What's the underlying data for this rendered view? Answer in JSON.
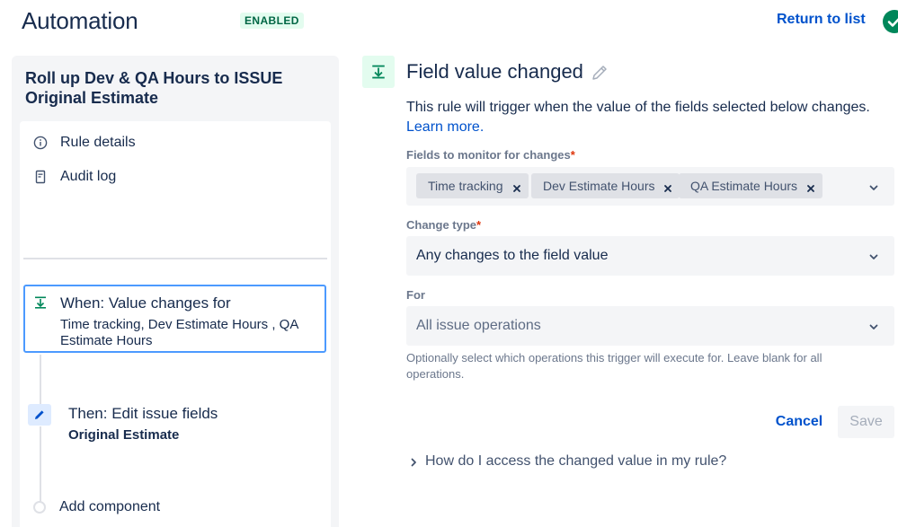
{
  "header": {
    "title": "Automation",
    "status_badge": "ENABLED",
    "return_link": "Return to list"
  },
  "rule": {
    "name": "Roll up Dev & QA Hours to ISSUE Original Estimate",
    "nav": {
      "rule_details": "Rule details",
      "audit_log": "Audit log"
    },
    "components": {
      "when_title": "When: Value changes for",
      "when_detail": "Time tracking, Dev Estimate Hours , QA Estimate Hours",
      "then_title": "Then: Edit issue fields",
      "then_detail": "Original Estimate",
      "add_label": "Add component"
    }
  },
  "trigger": {
    "title": "Field value changed",
    "description": "This rule will trigger when the value of the fields selected below changes.",
    "learn_more": "Learn more.",
    "fields_label": "Fields to monitor for changes",
    "fields": [
      "Time tracking",
      "Dev Estimate Hours",
      "QA Estimate Hours"
    ],
    "change_type_label": "Change type",
    "change_type_value": "Any changes to the field value",
    "for_label": "For",
    "for_value": "All issue operations",
    "for_help": "Optionally select which operations this trigger will execute for. Leave blank for all operations.",
    "required_marker": "*",
    "cancel_label": "Cancel",
    "save_label": "Save",
    "faq": "How do I access the changed value in my rule?"
  },
  "colors": {
    "accent_blue": "#0052cc",
    "enabled_green": "#006644",
    "selection_border": "#4c9aff"
  }
}
